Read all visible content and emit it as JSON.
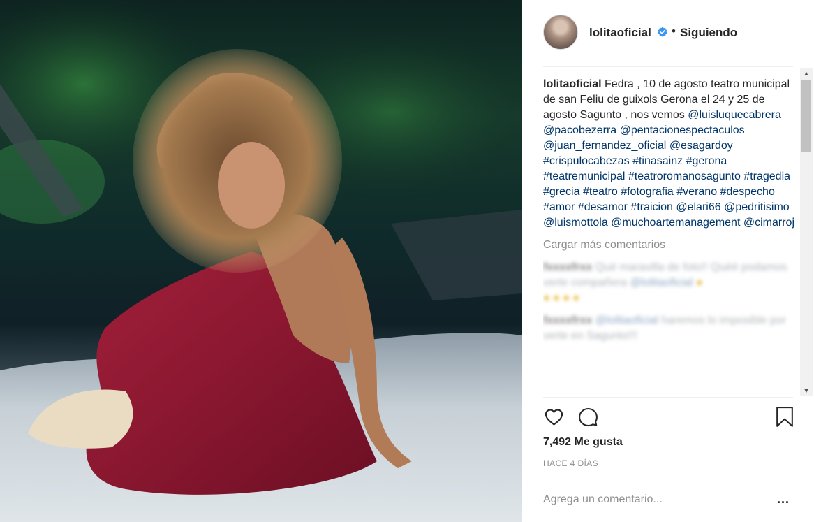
{
  "post": {
    "username": "lolitaoficial",
    "verified_icon": "verified-badge-icon",
    "separator": "•",
    "follow_status": "Siguiendo",
    "caption": {
      "user": "lolitaoficial",
      "text": "Fedra , 10 de agosto teatro municipal de san Feliu de guixols Gerona el 24 y 25 de agosto Sagunto , nos vemos",
      "tags": [
        "@luisluquecabrera",
        "@pacobezerra",
        "@pentacionespectaculos",
        "@juan_fernandez_oficial",
        "@esagardoy",
        "#crispulocabezas",
        "#tinasainz",
        "#gerona",
        "#teatremunicipal",
        "#teatroromanosagunto",
        "#tragedia",
        "#grecia",
        "#teatro",
        "#fotografia",
        "#verano",
        "#despecho",
        "#amor",
        "#desamor",
        "#traicion",
        "@elari66",
        "@pedritisimo",
        "@luismottola",
        "@muchoartemanagement",
        "@cimarroj"
      ]
    },
    "load_more": "Cargar más comentarios",
    "likes": "7,492 Me gusta",
    "time_ago": "HACE 4 DÍAS",
    "comment_placeholder": "Agrega un comentario...",
    "more_label": "..."
  },
  "icons": {
    "like": "heart-icon",
    "comment": "comment-bubble-icon",
    "save": "bookmark-icon",
    "scroll_up": "scroll-up-arrow-icon",
    "scroll_down": "scroll-down-arrow-icon"
  },
  "colors": {
    "link": "#003569",
    "muted": "#8e8e8e",
    "verified": "#3897f0"
  }
}
